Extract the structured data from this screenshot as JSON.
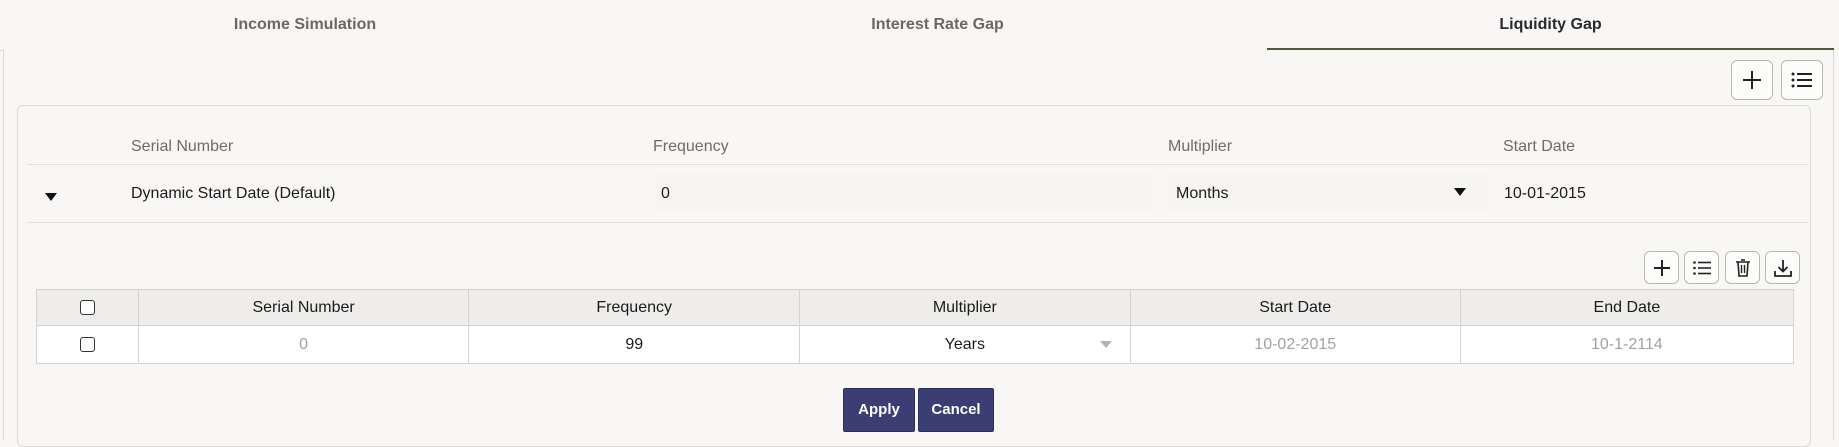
{
  "tabs": [
    {
      "label": "Income Simulation"
    },
    {
      "label": "Interest Rate Gap"
    },
    {
      "label": "Liquidity Gap"
    }
  ],
  "toolbar": {
    "add_icon": "plus-icon",
    "list_icon": "list-icon"
  },
  "top_headers": {
    "serial_number": "Serial Number",
    "frequency": "Frequency",
    "multiplier": "Multiplier",
    "start_date": "Start Date"
  },
  "top_row": {
    "serial_number": "Dynamic Start Date (Default)",
    "frequency": "0",
    "multiplier": "Months",
    "start_date": "10-01-2015"
  },
  "grid": {
    "headers": {
      "serial_number": "Serial Number",
      "frequency": "Frequency",
      "multiplier": "Multiplier",
      "start_date": "Start Date",
      "end_date": "End Date"
    },
    "rows": [
      {
        "serial_number": "0",
        "frequency": "99",
        "multiplier": "Years",
        "start_date": "10-02-2015",
        "end_date": "10-1-2114"
      }
    ]
  },
  "actions": {
    "apply": "Apply",
    "cancel": "Cancel"
  },
  "colors": {
    "primary_button": "#3a3e73",
    "active_tab_underline": "#4f5a3b"
  }
}
